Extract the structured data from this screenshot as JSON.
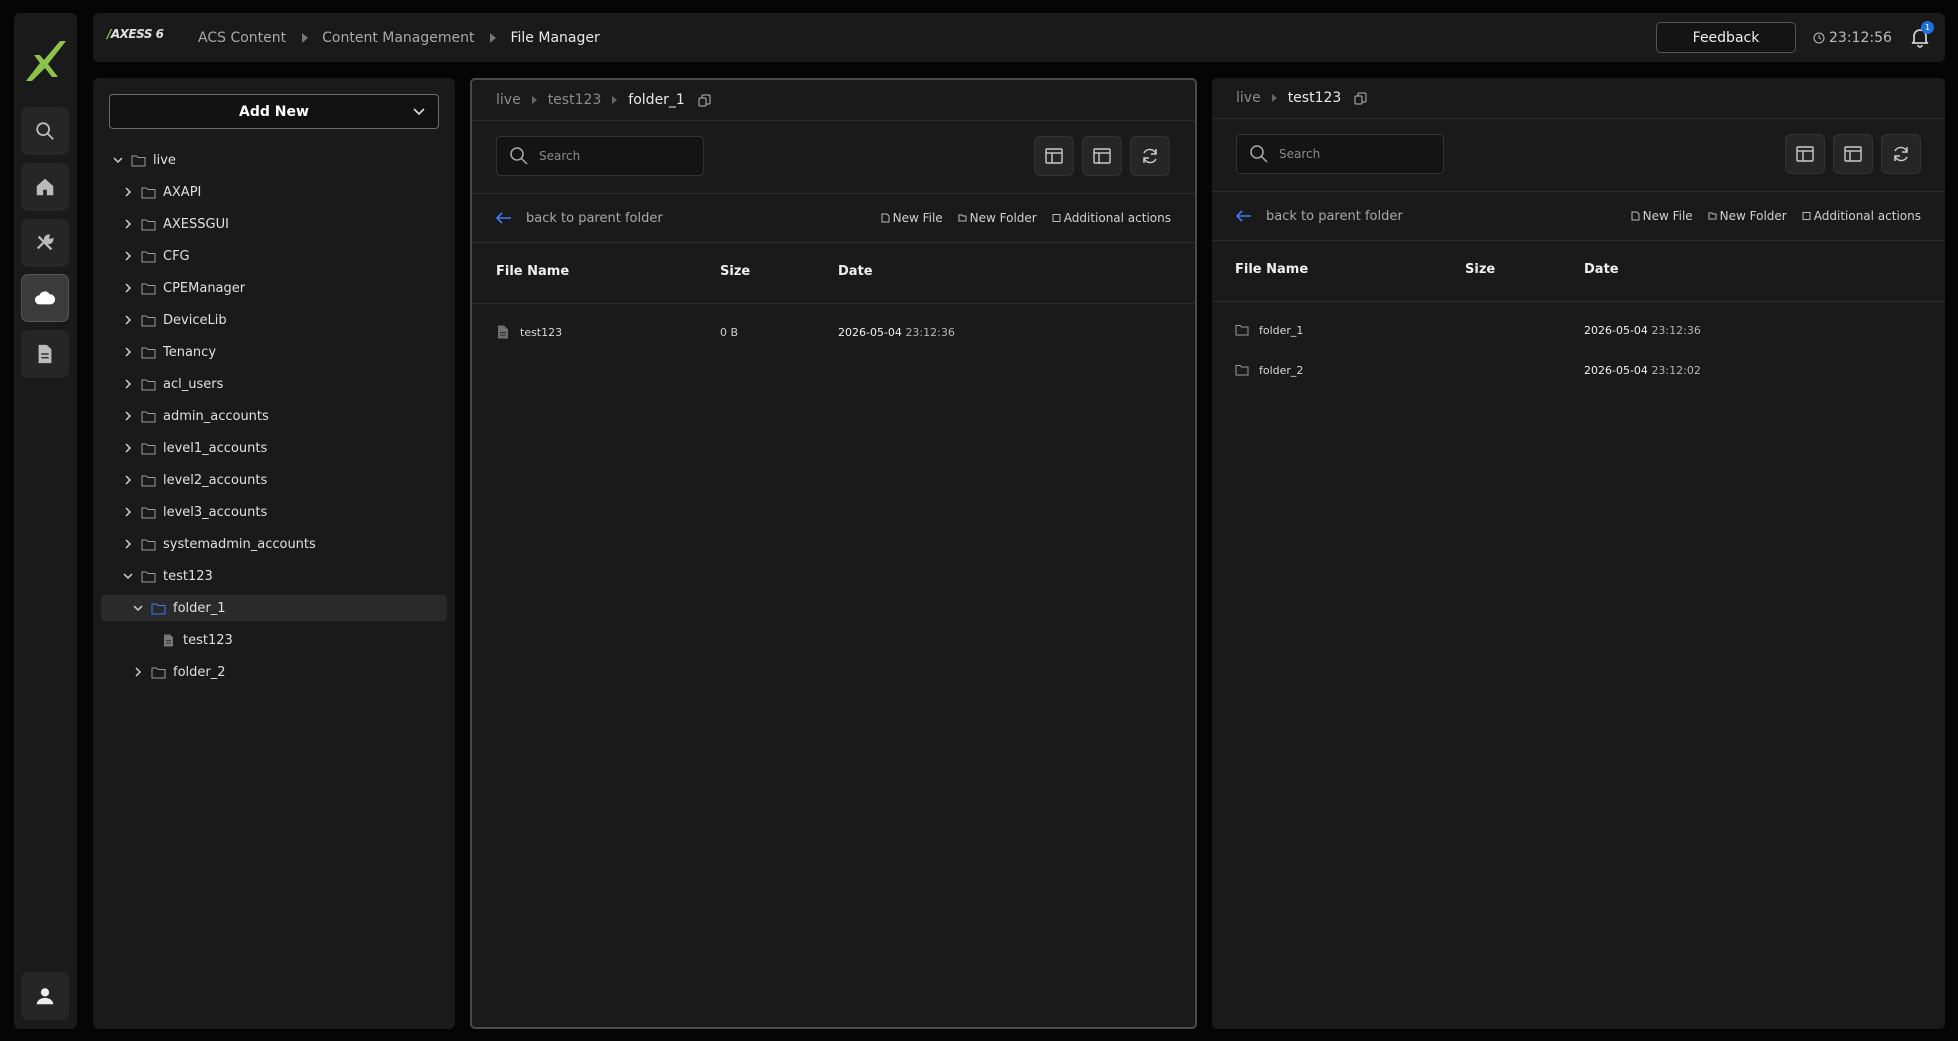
{
  "app": {
    "brand": "AXESS",
    "brand_version": "6"
  },
  "header": {
    "breadcrumbs": [
      "ACS Content",
      "Content Management",
      "File Manager"
    ],
    "feedback_label": "Feedback",
    "clock": "23:12:56",
    "notification_count": "1"
  },
  "sidebar": {
    "items": [
      {
        "icon": "search-icon"
      },
      {
        "icon": "home-icon"
      },
      {
        "icon": "tools-icon"
      },
      {
        "icon": "cloud-icon",
        "active": true
      },
      {
        "icon": "document-icon"
      }
    ],
    "user_icon": "user-icon"
  },
  "tree": {
    "add_new_label": "Add New",
    "nodes": [
      {
        "label": "live",
        "level": 0,
        "type": "folder",
        "expanded": true
      },
      {
        "label": "AXAPI",
        "level": 1,
        "type": "folder"
      },
      {
        "label": "AXESSGUI",
        "level": 1,
        "type": "folder"
      },
      {
        "label": "CFG",
        "level": 1,
        "type": "folder"
      },
      {
        "label": "CPEManager",
        "level": 1,
        "type": "folder"
      },
      {
        "label": "DeviceLib",
        "level": 1,
        "type": "folder"
      },
      {
        "label": "Tenancy",
        "level": 1,
        "type": "folder"
      },
      {
        "label": "acl_users",
        "level": 1,
        "type": "folder"
      },
      {
        "label": "admin_accounts",
        "level": 1,
        "type": "folder"
      },
      {
        "label": "level1_accounts",
        "level": 1,
        "type": "folder"
      },
      {
        "label": "level2_accounts",
        "level": 1,
        "type": "folder"
      },
      {
        "label": "level3_accounts",
        "level": 1,
        "type": "folder"
      },
      {
        "label": "systemadmin_accounts",
        "level": 1,
        "type": "folder"
      },
      {
        "label": "test123",
        "level": 1,
        "type": "folder",
        "expanded": true
      },
      {
        "label": "folder_1",
        "level": 2,
        "type": "folder",
        "expanded": true,
        "selected": true
      },
      {
        "label": "test123",
        "level": 3,
        "type": "file"
      },
      {
        "label": "folder_2",
        "level": 2,
        "type": "folder"
      }
    ]
  },
  "left_pane": {
    "breadcrumbs": [
      "live",
      "test123",
      "folder_1"
    ],
    "search_placeholder": "Search",
    "back_label": "back to parent folder",
    "actions": [
      "New File",
      "New Folder",
      "Additional actions"
    ],
    "columns": [
      "File Name",
      "Size",
      "Date"
    ],
    "rows": [
      {
        "type": "file",
        "name": "test123",
        "size": "0 B",
        "date": "2026-05-04",
        "time": "23:12:36"
      }
    ]
  },
  "right_pane": {
    "breadcrumbs": [
      "live",
      "test123"
    ],
    "search_placeholder": "Search",
    "back_label": "back to parent folder",
    "actions": [
      "New File",
      "New Folder",
      "Additional actions"
    ],
    "columns": [
      "File Name",
      "Size",
      "Date"
    ],
    "rows": [
      {
        "type": "folder",
        "name": "folder_1",
        "size": "",
        "date": "2026-05-04",
        "time": "23:12:36"
      },
      {
        "type": "folder",
        "name": "folder_2",
        "size": "",
        "date": "2026-05-04",
        "time": "23:12:02"
      }
    ]
  },
  "colors": {
    "accent_green": "#8bc34a",
    "accent_blue": "#3d7bf5",
    "badge_blue": "#1e6fd9"
  }
}
